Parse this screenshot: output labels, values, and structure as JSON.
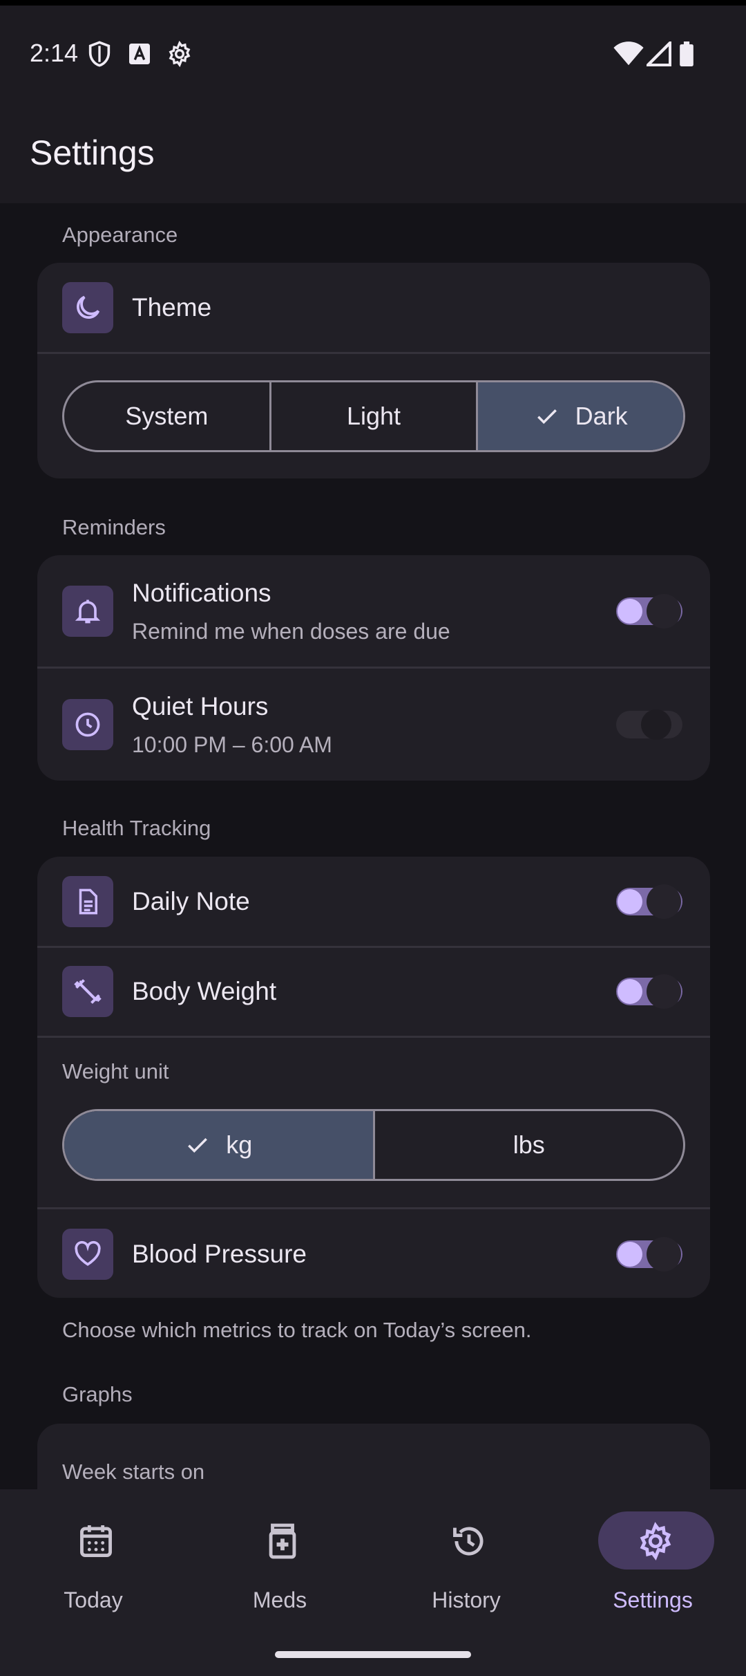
{
  "status_bar": {
    "time": "2:14",
    "left_icons": [
      "shield-icon",
      "font-a-icon",
      "gear-icon"
    ],
    "right_icons": [
      "wifi-icon",
      "signal-icon",
      "battery-icon"
    ]
  },
  "app_bar": {
    "title": "Settings"
  },
  "appearance": {
    "section_label": "Appearance",
    "theme_label": "Theme",
    "theme_options": [
      "System",
      "Light",
      "Dark"
    ],
    "theme_selected": "Dark"
  },
  "reminders": {
    "section_label": "Reminders",
    "notifications": {
      "title": "Notifications",
      "subtitle": "Remind me when doses are due",
      "enabled": true
    },
    "quiet_hours": {
      "title": "Quiet Hours",
      "subtitle": "10:00 PM – 6:00 AM",
      "enabled": false
    }
  },
  "health_tracking": {
    "section_label": "Health Tracking",
    "daily_note": {
      "title": "Daily Note",
      "enabled": true
    },
    "body_weight": {
      "title": "Body Weight",
      "enabled": true
    },
    "weight_unit": {
      "label": "Weight unit",
      "options": [
        "kg",
        "lbs"
      ],
      "selected": "kg"
    },
    "blood_pressure": {
      "title": "Blood Pressure",
      "enabled": true
    },
    "footnote": "Choose which metrics to track on Today’s screen."
  },
  "graphs": {
    "section_label": "Graphs",
    "week_starts_label": "Week starts on"
  },
  "bottom_nav": {
    "items": [
      {
        "label": "Today",
        "icon": "calendar-icon"
      },
      {
        "label": "Meds",
        "icon": "medicine-icon"
      },
      {
        "label": "History",
        "icon": "history-icon"
      },
      {
        "label": "Settings",
        "icon": "gear-icon"
      }
    ],
    "active": "Settings"
  },
  "colors": {
    "background": "#141318",
    "surface": "#211f26",
    "accent": "#cfbcff",
    "icon_container": "#463a60",
    "segment_selected": "#465068"
  }
}
